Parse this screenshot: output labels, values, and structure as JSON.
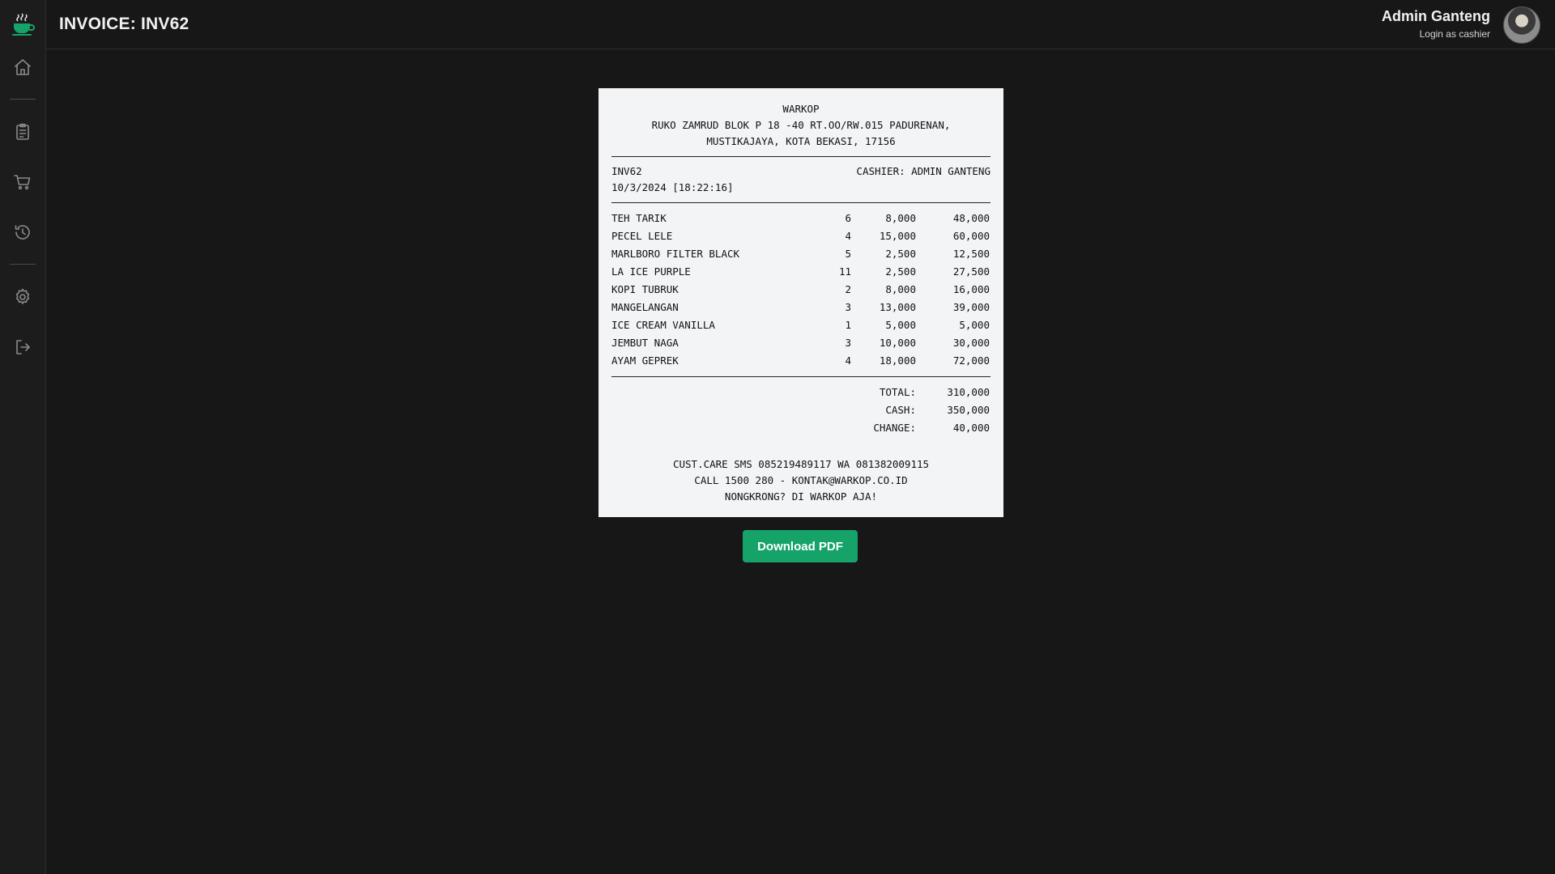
{
  "header": {
    "title": "INVOICE: INV62",
    "user_name": "Admin Ganteng",
    "user_role": "Login as cashier"
  },
  "sidebar": {
    "items": [
      {
        "icon": "home-icon"
      },
      {
        "icon": "clipboard-icon"
      },
      {
        "icon": "cart-icon"
      },
      {
        "icon": "history-icon"
      },
      {
        "icon": "gear-icon"
      },
      {
        "icon": "logout-icon"
      }
    ]
  },
  "receipt": {
    "store_name": "WARKOP",
    "address_line1": "RUKO ZAMRUD BLOK P 18 -40 RT.OO/RW.015 PADURENAN,",
    "address_line2": "MUSTIKAJAYA, KOTA BEKASI, 17156",
    "invoice_no": "INV62",
    "cashier": "CASHIER: ADMIN GANTENG",
    "datetime": "10/3/2024 [18:22:16]",
    "items": [
      {
        "name": "TEH TARIK",
        "qty": "6",
        "price": "8,000",
        "total": "48,000"
      },
      {
        "name": "PECEL LELE",
        "qty": "4",
        "price": "15,000",
        "total": "60,000"
      },
      {
        "name": "MARLBORO FILTER BLACK",
        "qty": "5",
        "price": "2,500",
        "total": "12,500"
      },
      {
        "name": "LA ICE PURPLE",
        "qty": "11",
        "price": "2,500",
        "total": "27,500"
      },
      {
        "name": "KOPI TUBRUK",
        "qty": "2",
        "price": "8,000",
        "total": "16,000"
      },
      {
        "name": "MANGELANGAN",
        "qty": "3",
        "price": "13,000",
        "total": "39,000"
      },
      {
        "name": "ICE CREAM VANILLA",
        "qty": "1",
        "price": "5,000",
        "total": "5,000"
      },
      {
        "name": "JEMBUT NAGA",
        "qty": "3",
        "price": "10,000",
        "total": "30,000"
      },
      {
        "name": "AYAM GEPREK",
        "qty": "4",
        "price": "18,000",
        "total": "72,000"
      }
    ],
    "total_label": "TOTAL:",
    "total_value": "310,000",
    "cash_label": "CASH:",
    "cash_value": "350,000",
    "change_label": "CHANGE:",
    "change_value": "40,000",
    "footer_line1": "CUST.CARE SMS 085219489117 WA 081382009115",
    "footer_line2": "CALL 1500 280 - KONTAK@WARKOP.CO.ID",
    "footer_line3": "NONGKRONG? DI WARKOP AJA!"
  },
  "actions": {
    "download_label": "Download PDF"
  },
  "colors": {
    "background": "#171717",
    "sidebar": "#1c1c1c",
    "accent_green": "#16a36a",
    "receipt_paper": "#f3f4f6"
  }
}
